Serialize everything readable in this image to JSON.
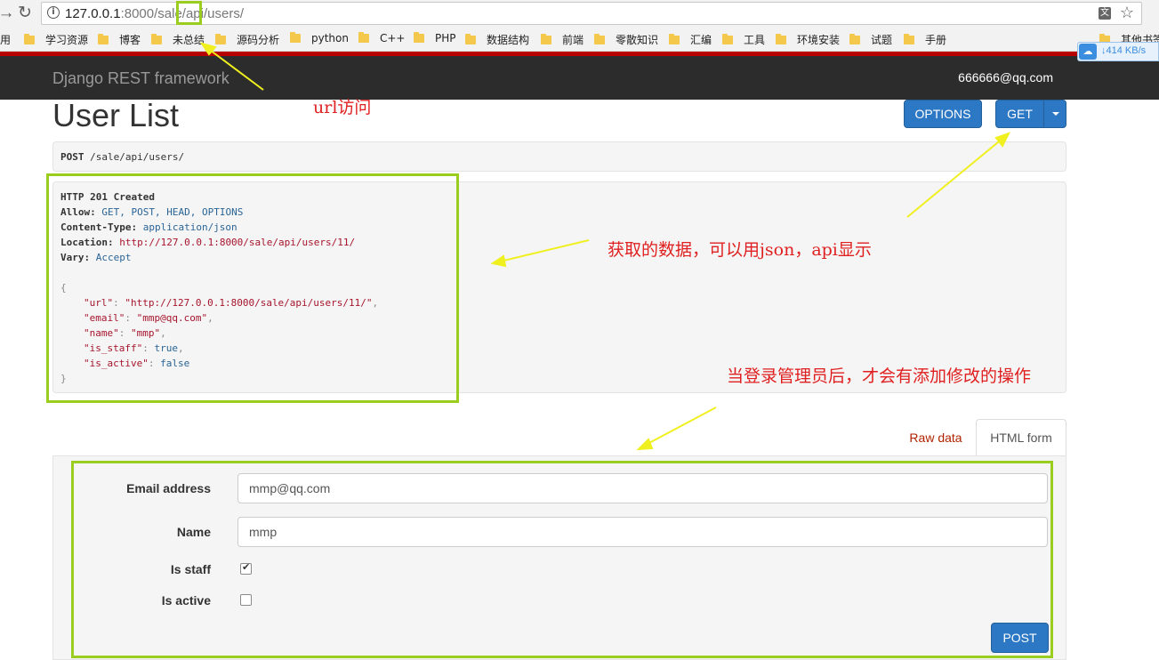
{
  "browser": {
    "url_host": "127.0.0.1",
    "url_rest": ":8000/sale/api/users/",
    "bookmarks": [
      "用",
      "学习资源",
      "博客",
      "未总结",
      "源码分析",
      "python",
      "C++",
      "PHP",
      "数据结构",
      "前端",
      "零散知识",
      "汇编",
      "工具",
      "环境安装",
      "试题",
      "手册",
      "其他书签"
    ],
    "speed": "↓414 KB/s"
  },
  "navbar": {
    "brand": "Django REST framework",
    "user": "666666@qq.com"
  },
  "page": {
    "title": "User List",
    "options_label": "OPTIONS",
    "get_label": "GET"
  },
  "request": {
    "method": "POST",
    "path": " /sale/api/users/"
  },
  "response": {
    "status": "HTTP 201 Created",
    "headers": [
      {
        "key": "Allow:",
        "value": " GET, POST, HEAD, OPTIONS"
      },
      {
        "key": "Content-Type:",
        "value": " application/json"
      },
      {
        "key": "Location:",
        "value": " http://127.0.0.1:8000/sale/api/users/11/"
      },
      {
        "key": "Vary:",
        "value": " Accept"
      }
    ],
    "body": {
      "open": "{",
      "fields": [
        {
          "key": "\"url\"",
          "value": "\"http://127.0.0.1:8000/sale/api/users/11/\"",
          "type": "str",
          "comma": ","
        },
        {
          "key": "\"email\"",
          "value": "\"mmp@qq.com\"",
          "type": "str",
          "comma": ","
        },
        {
          "key": "\"name\"",
          "value": "\"mmp\"",
          "type": "str",
          "comma": ","
        },
        {
          "key": "\"is_staff\"",
          "value": "true",
          "type": "lit",
          "comma": ","
        },
        {
          "key": "\"is_active\"",
          "value": "false",
          "type": "lit",
          "comma": ""
        }
      ],
      "close": "}"
    }
  },
  "annotations": {
    "url_access": "url访问",
    "data_display": "获取的数据，可以用json，api显示",
    "admin_note": "当登录管理员后，才会有添加修改的操作"
  },
  "tabs": {
    "raw": "Raw data",
    "html": "HTML form"
  },
  "form": {
    "email_label": "Email address",
    "email_value": "mmp@qq.com",
    "name_label": "Name",
    "name_value": "mmp",
    "is_staff_label": "Is staff",
    "is_staff": true,
    "is_active_label": "Is active",
    "is_active": false,
    "post_label": "POST"
  },
  "colors": {
    "accent_blue": "#2c78c4",
    "navbar": "#2c2c2c",
    "highlight_green": "#9acd1e",
    "annotation_red": "#e02020",
    "arrow_yellow": "#f0f020"
  }
}
